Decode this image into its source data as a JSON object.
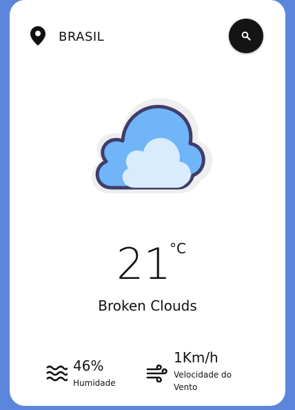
{
  "location": {
    "name": "BRASIL"
  },
  "icons": {
    "location": "map-pin-icon",
    "search": "search-icon",
    "weather": "broken-clouds-icon",
    "humidity": "humidity-waves-icon",
    "wind": "wind-icon"
  },
  "weather": {
    "temperature": "21",
    "unit": "°C",
    "description": "Broken Clouds"
  },
  "stats": {
    "humidity": {
      "value": "46%",
      "label": "Humidade"
    },
    "wind": {
      "value": "1Km/h",
      "label": "Velocidade do Vento"
    }
  },
  "colors": {
    "background": "#5b86dc",
    "card": "#ffffff",
    "search_button": "#141414",
    "cloud_back": "#6fb5f7",
    "cloud_front": "#d8ecfd",
    "cloud_outline": "#3f3d6b"
  }
}
